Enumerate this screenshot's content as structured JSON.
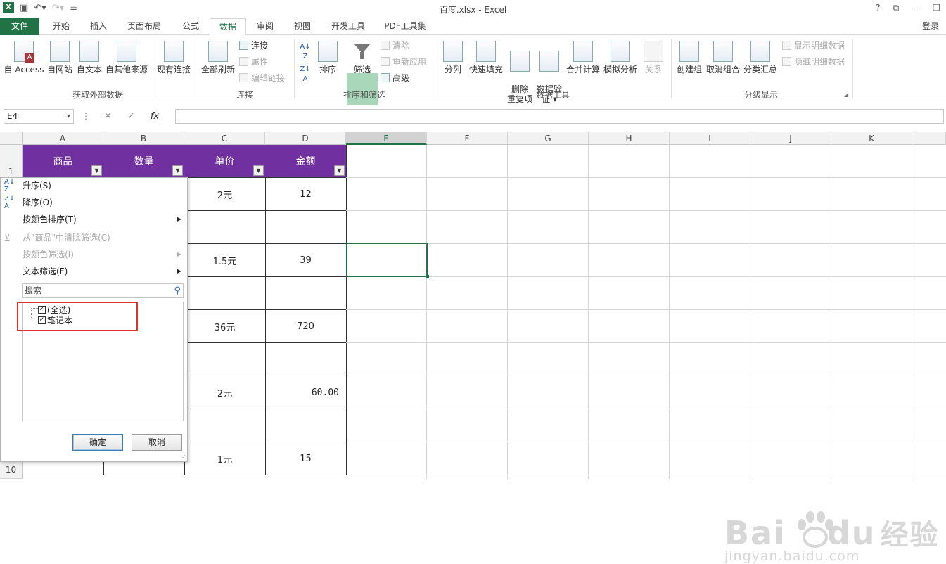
{
  "window": {
    "title": "百度.xlsx - Excel",
    "login": "登录",
    "help": "?",
    "minimize": "—",
    "restore": "❐"
  },
  "tabs": [
    "文件",
    "开始",
    "插入",
    "页面布局",
    "公式",
    "数据",
    "审阅",
    "视图",
    "开发工具",
    "PDF工具集"
  ],
  "ribbon": {
    "groups": [
      "获取外部数据",
      "连接",
      "排序和筛选",
      "数据工具",
      "分级显示"
    ],
    "ext_data": [
      "自 Access",
      "自网站",
      "自文本",
      "自其他来源",
      "现有连接"
    ],
    "conn": {
      "refresh_all": "全部刷新",
      "connections": "连接",
      "properties": "属性",
      "edit_links": "编辑链接"
    },
    "sort": {
      "sort": "排序",
      "filter": "筛选",
      "clear": "清除",
      "reapply": "重新应用",
      "advanced": "高级"
    },
    "tools": [
      "分列",
      "快速填充",
      "删除\n重复项",
      "数据验\n证 ▾",
      "合并计算",
      "模拟分析",
      "关系"
    ],
    "outline": {
      "group": "创建组",
      "ungroup": "取消组合",
      "subtotal": "分类汇总",
      "show_detail": "显示明细数据",
      "hide_detail": "隐藏明细数据"
    }
  },
  "formula_bar": {
    "name_box": "E4",
    "cancel": "✕",
    "enter": "✓",
    "fx": "fx",
    "formula": ""
  },
  "columns": [
    "A",
    "B",
    "C",
    "D",
    "E",
    "F",
    "G",
    "H",
    "I",
    "J",
    "K"
  ],
  "rows": [
    "1",
    "10"
  ],
  "headers": [
    "商品",
    "数量",
    "单价",
    "金额"
  ],
  "cells": {
    "c2": "2元",
    "d2": "12",
    "c4": "1.5元",
    "d4": "39",
    "c6": "36元",
    "d6": "720",
    "c8": "2元",
    "d8": "60.00",
    "c10": "1元",
    "d10": "15"
  },
  "filter_menu": {
    "sort_asc": "升序(S)",
    "sort_desc": "降序(O)",
    "sort_by_color": "按颜色排序(T)",
    "clear_filter": "从\"商品\"中清除筛选(C)",
    "filter_by_color": "按颜色筛选(I)",
    "text_filter": "文本筛选(F)",
    "search_placeholder": "搜索",
    "items": [
      "(全选)",
      "笔记本"
    ],
    "ok": "确定",
    "cancel": "取消"
  },
  "watermark": {
    "brand": "Bai",
    "brand_du": "du",
    "brand_cn": "经验",
    "url": "jingyan.baidu.com"
  }
}
